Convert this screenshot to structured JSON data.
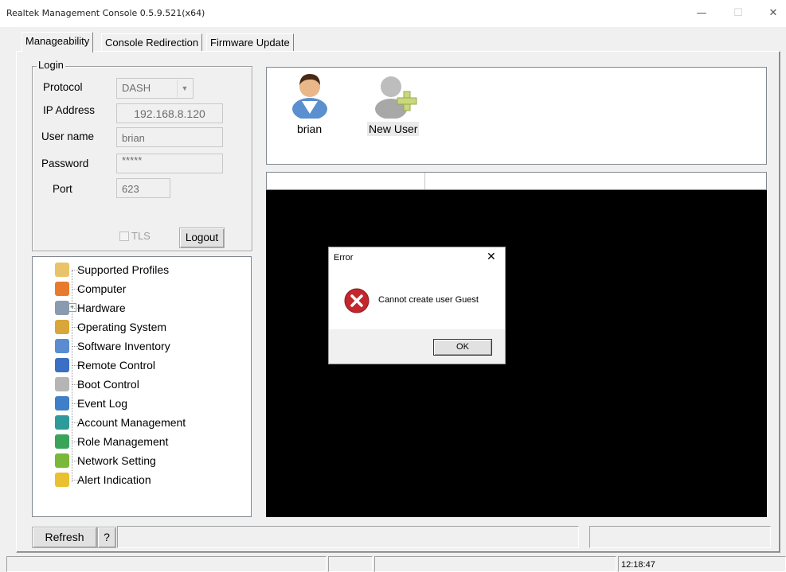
{
  "window": {
    "title": "Realtek Management Console 0.5.9.521(x64)",
    "minimize": "—",
    "maximize": "☐",
    "close": "✕"
  },
  "tabs": [
    {
      "label": "Manageability"
    },
    {
      "label": "Console Redirection"
    },
    {
      "label": "Firmware Update"
    }
  ],
  "login": {
    "legend": "Login",
    "protocol_label": "Protocol",
    "protocol_value": "DASH",
    "ip_label": "IP Address",
    "ip_value": "192.168.8.120",
    "username_label": "User name",
    "username_value": "brian",
    "password_label": "Password",
    "password_value": "*****",
    "port_label": "Port",
    "port_value": "623",
    "tls_label": "TLS",
    "logout_label": "Logout"
  },
  "tree": {
    "items": [
      {
        "label": "Supported Profiles",
        "icon": "profiles-icon",
        "color": "#e8c36a"
      },
      {
        "label": "Computer",
        "icon": "computer-icon",
        "color": "#e87a2e"
      },
      {
        "label": "Hardware",
        "icon": "hardware-icon",
        "color": "#8a9bb0"
      },
      {
        "label": "Operating System",
        "icon": "windows-icon",
        "color": "#d9a63a"
      },
      {
        "label": "Software Inventory",
        "icon": "software-icon",
        "color": "#5b8bd0"
      },
      {
        "label": "Remote Control",
        "icon": "remote-control-icon",
        "color": "#3a6fc4"
      },
      {
        "label": "Boot Control",
        "icon": "boot-icon",
        "color": "#b5b5b5"
      },
      {
        "label": "Event Log",
        "icon": "event-log-icon",
        "color": "#3f7fc8"
      },
      {
        "label": "Account Management",
        "icon": "lock-icon",
        "color": "#2f9a9a"
      },
      {
        "label": "Role Management",
        "icon": "role-icon",
        "color": "#3aa35a"
      },
      {
        "label": "Network Setting",
        "icon": "network-icon",
        "color": "#7ab83a"
      },
      {
        "label": "Alert Indication",
        "icon": "alert-icon",
        "color": "#e8c030"
      }
    ]
  },
  "users": [
    {
      "label": "brian",
      "icon": "user-icon"
    },
    {
      "label": "New User",
      "icon": "add-user-icon"
    }
  ],
  "dialog": {
    "title": "Error",
    "message": "Cannot create user Guest",
    "ok_label": "OK",
    "close": "✕"
  },
  "bottom": {
    "refresh_label": "Refresh",
    "help_label": "?"
  },
  "statusbar": {
    "time": "12:18:47"
  }
}
